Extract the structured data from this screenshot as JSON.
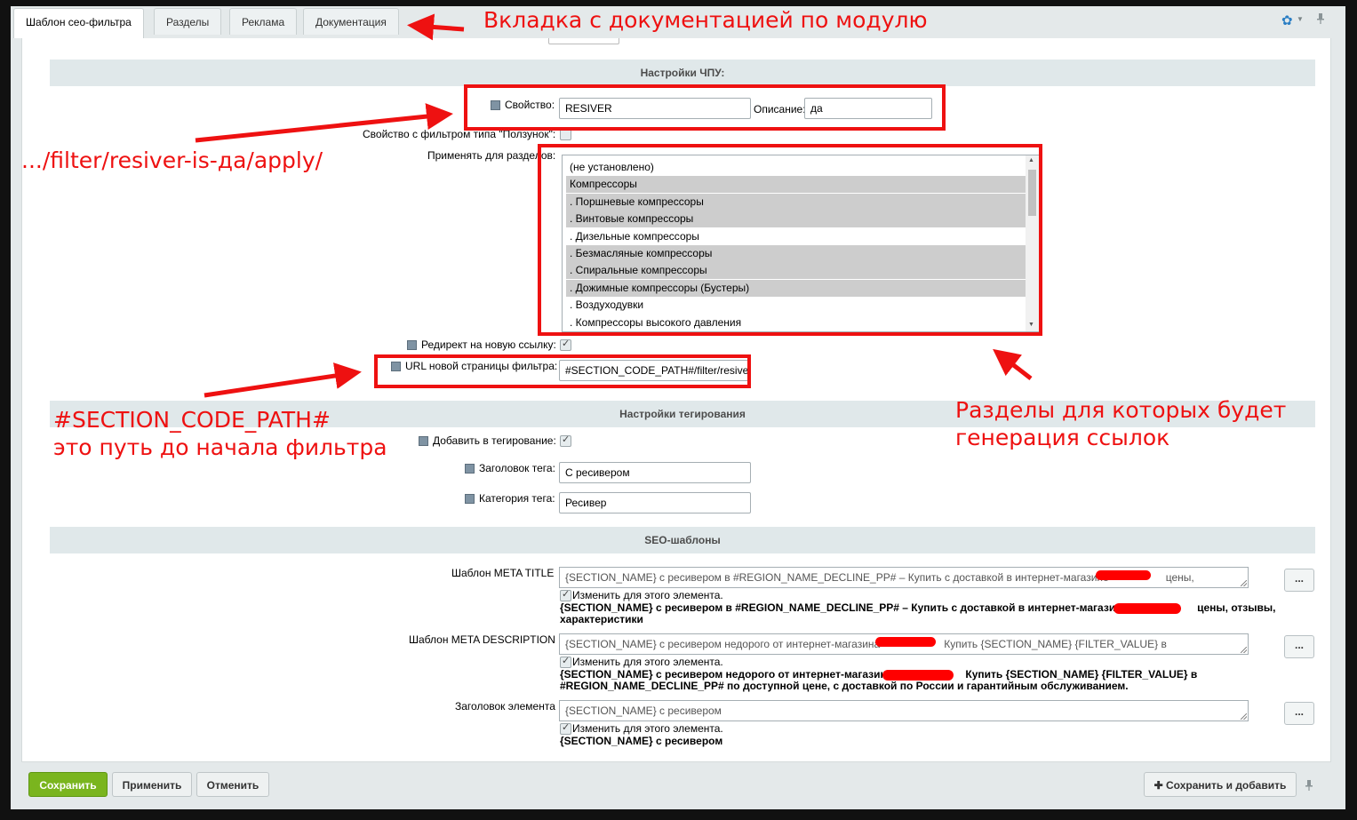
{
  "tabs": [
    "Шаблон сео-фильтра",
    "Разделы",
    "Реклама",
    "Документация"
  ],
  "sections": {
    "chpu": "Настройки ЧПУ:",
    "tagging": "Настройки тегирования",
    "seo": "SEO-шаблоны"
  },
  "property": {
    "label": "Свойство:",
    "value": "RESIVER",
    "desc_label": "Описание:",
    "desc_value": "да"
  },
  "slider_label": "Свойство с фильтром типа \"Ползунок\":",
  "sections_label": "Применять для разделов:",
  "sections_list": [
    {
      "text": "(не установлено)",
      "selected": false
    },
    {
      "text": "Компрессоры",
      "selected": true
    },
    {
      "text": ". Поршневые компрессоры",
      "selected": true
    },
    {
      "text": ". Винтовые компрессоры",
      "selected": true
    },
    {
      "text": ". Дизельные компрессоры",
      "selected": false
    },
    {
      "text": ". Безмасляные компрессоры",
      "selected": true
    },
    {
      "text": ". Спиральные компрессоры",
      "selected": true
    },
    {
      "text": ". Дожимные компрессоры (Бустеры)",
      "selected": true
    },
    {
      "text": ". Воздуходувки",
      "selected": false
    },
    {
      "text": ". Компрессоры высокого давления",
      "selected": false
    }
  ],
  "redirect_label": "Редирект на новую ссылку:",
  "url_label": "URL новой страницы фильтра:",
  "url_value": "#SECTION_CODE_PATH#/filter/resiver",
  "tag_add_label": "Добавить в тегирование:",
  "tag_title_label": "Заголовок тега:",
  "tag_title_value": "С ресивером",
  "tag_cat_label": "Категория тега:",
  "tag_cat_value": "Ресивер",
  "seo": {
    "meta_title_label": "Шаблон META TITLE",
    "meta_title_value": "{SECTION_NAME} с ресивером в #REGION_NAME_DECLINE_PP# – Купить с доставкой в интернет-магазине",
    "meta_title_value_tail": "цены,",
    "meta_title_result_1": "{SECTION_NAME} с ресивером в #REGION_NAME_DECLINE_PP# – Купить с доставкой в интернет-магазине",
    "meta_title_result_tail": "цены, отзывы,",
    "meta_title_result_2": "характеристики",
    "meta_desc_label": "Шаблон META DESCRIPTION",
    "meta_desc_value": "{SECTION_NAME} с ресивером недорого от интернет-магазина",
    "meta_desc_value_tail": "Купить {SECTION_NAME} {FILTER_VALUE}  в",
    "meta_desc_result_1a": "{SECTION_NAME} с ресивером недорого от интернет-магазина",
    "meta_desc_result_1b": "Купить {SECTION_NAME} {FILTER_VALUE} в",
    "meta_desc_result_2": "#REGION_NAME_DECLINE_PP# по доступной цене, с доставкой по России и гарантийным обслуживанием.",
    "header_label": "Заголовок элемента",
    "header_value": "{SECTION_NAME} с ресивером",
    "header_result": "{SECTION_NAME} с ресивером",
    "change_label": "Изменить для этого элемента.",
    "dots": "..."
  },
  "buttons": {
    "save": "Сохранить",
    "apply": "Применить",
    "cancel": "Отменить",
    "save_add": "Сохранить и добавить"
  },
  "annotations": {
    "doc_tab": "Вкладка с документацией по модулю",
    "filter_url": ".../filter/resiver-is-да/apply/",
    "scp_1": "#SECTION_CODE_PATH#",
    "scp_2": "это путь до начала фильтра",
    "sections_1": "Разделы для которых будет",
    "sections_2": "генерация ссылок"
  },
  "colors": {
    "annotation_red": "#ee1111",
    "save_green": "#7ab51e",
    "section_bg": "#e0e8ea"
  }
}
